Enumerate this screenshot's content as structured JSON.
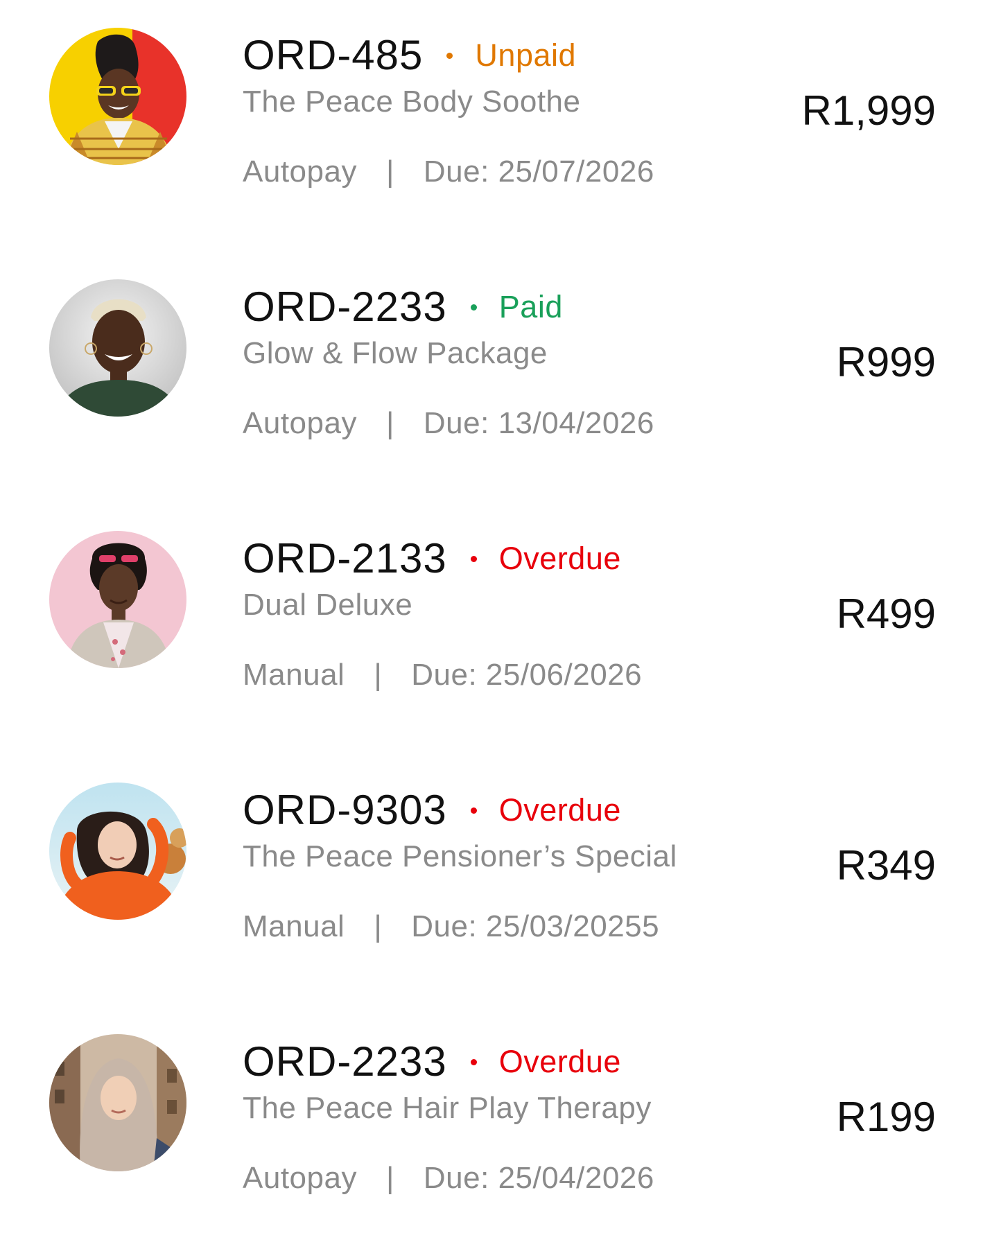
{
  "orders": [
    {
      "id": "ORD-485",
      "status": "Unpaid",
      "status_color": "#e07800",
      "package": "The Peace Body Soothe",
      "payment_type": "Autopay",
      "separator": "|",
      "due": "Due: 25/07/2026",
      "amount": "R1,999",
      "avatar": "avatar-photo-yellow-red-background"
    },
    {
      "id": "ORD-2233",
      "status": "Paid",
      "status_color": "#1aa05a",
      "package": "Glow & Flow Package",
      "payment_type": "Autopay",
      "separator": "|",
      "due": "Due: 13/04/2026",
      "amount": "R999",
      "avatar": "avatar-photo-grey-background"
    },
    {
      "id": "ORD-2133",
      "status": "Overdue",
      "status_color": "#e8000b",
      "package": "Dual Deluxe",
      "payment_type": "Manual",
      "separator": "|",
      "due": "Due: 25/06/2026",
      "amount": "R499",
      "avatar": "avatar-photo-pink-background"
    },
    {
      "id": "ORD-9303",
      "status": "Overdue",
      "status_color": "#e8000b",
      "package": "The Peace Pensioner’s Special",
      "payment_type": "Manual",
      "separator": "|",
      "due": "Due: 25/03/20255",
      "amount": "R349",
      "avatar": "avatar-photo-orange-sweater"
    },
    {
      "id": "ORD-2233",
      "status": "Overdue",
      "status_color": "#e8000b",
      "package": "The Peace Hair Play Therapy",
      "payment_type": "Autopay",
      "separator": "|",
      "due": "Due: 25/04/2026",
      "amount": "R199",
      "avatar": "avatar-photo-street-background"
    }
  ]
}
